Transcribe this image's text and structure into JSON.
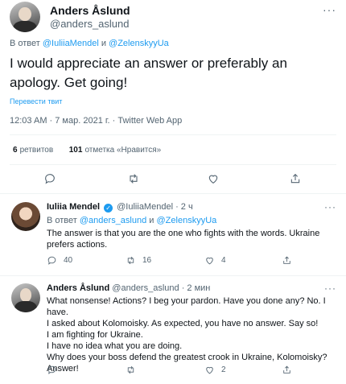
{
  "main_tweet": {
    "author_name": "Anders Åslund",
    "author_handle": "@anders_aslund",
    "reply_prefix": "В ответ",
    "reply_to_1": "@IuliiaMendel",
    "reply_and": "и",
    "reply_to_2": "@ZelenskyyUa",
    "text": "I would appreciate an answer or preferably an apology. Get going!",
    "translate_label": "Перевести твит",
    "timestamp": "12:03 AM · 7 мар. 2021 г. · Twitter Web App",
    "retweets_count": "6",
    "retweets_label": "ретвитов",
    "likes_count": "101",
    "likes_label": "отметка «Нравится»",
    "more": "···"
  },
  "replies": [
    {
      "author_name": "Iuliia Mendel",
      "verified": true,
      "verified_glyph": "✓",
      "author_handle": "@IuliiaMendel",
      "time": "· 2 ч",
      "reply_prefix": "В ответ",
      "reply_to_1": "@anders_aslund",
      "reply_and": "и",
      "reply_to_2": "@ZelenskyyUa",
      "text_lines": [
        "The answer is that you are the one who fights with the words. Ukraine",
        "prefers actions."
      ],
      "replies_count": "40",
      "retweets_count": "16",
      "likes_count": "4",
      "more": "···"
    },
    {
      "author_name": "Anders Åslund",
      "author_handle": "@anders_aslund",
      "time": "· 2 мин",
      "text_lines": [
        "What nonsense! Actions? I beg your pardon. Have you done any? No. I have.",
        "I asked about Kolomoisky. As expected, you have no answer. Say so!",
        "I am fighting for Ukraine.",
        "I have no idea what you are doing.",
        "Why does your boss defend the greatest crook in Ukraine, Kolomoisky?",
        "Answer!"
      ],
      "likes_count": "2",
      "more": "···"
    }
  ],
  "icons": [
    "reply-icon",
    "retweet-icon",
    "like-icon",
    "share-icon",
    "verified-icon",
    "more-icon"
  ],
  "colors": {
    "accent": "#1d9bf0",
    "muted": "#536471",
    "text": "#0f1419",
    "divider": "#eff3f4"
  }
}
